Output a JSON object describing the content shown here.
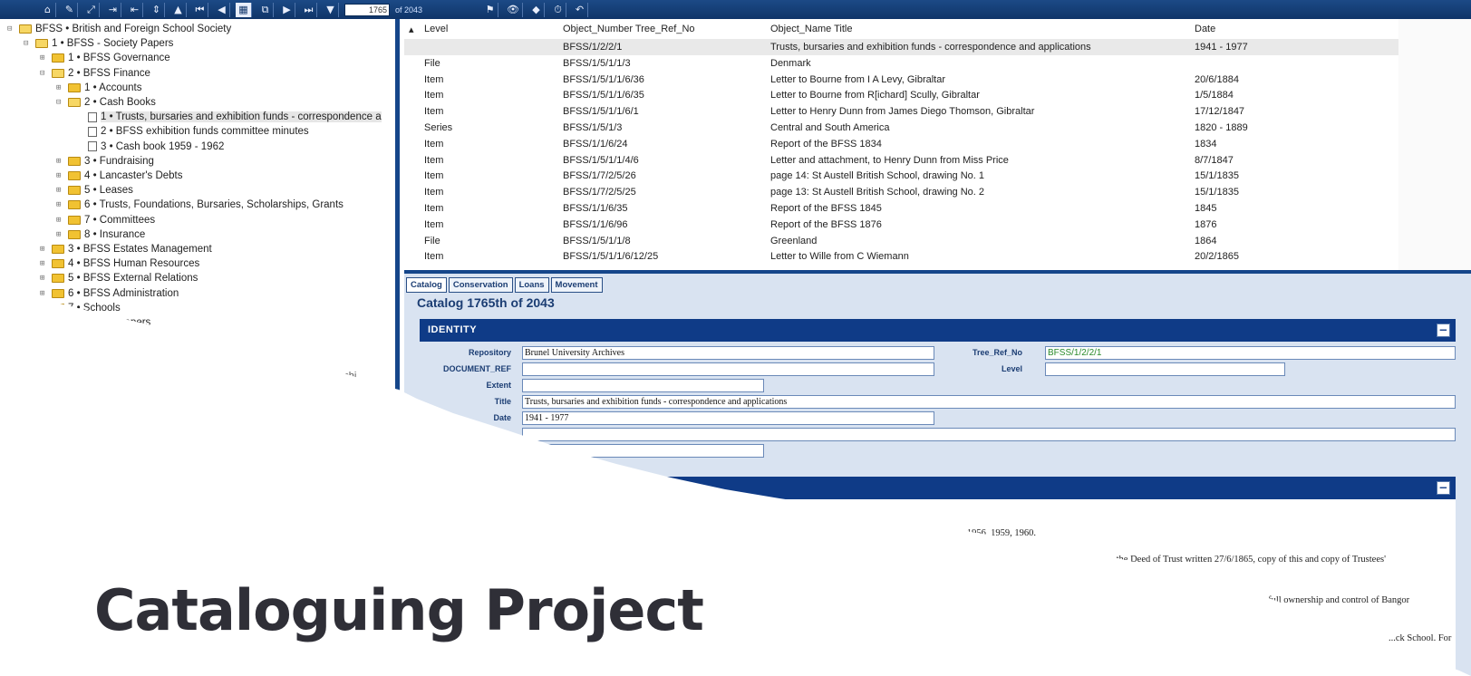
{
  "toolbar": {
    "buttons": [
      "⌂",
      "✎",
      "⤢",
      "⇥",
      "⇤",
      "⇕",
      "▲",
      "⏮",
      "◀",
      "▦",
      "⧉",
      "▶",
      "⏭",
      "▼"
    ],
    "record_value": "1765",
    "record_of": "of 2043",
    "right_buttons": [
      "⚑",
      "👁",
      "◆",
      "⏱",
      "↶"
    ]
  },
  "tree": {
    "items": [
      {
        "exp": "⊟",
        "icon": "folder open",
        "label": "BFSS • British and Foreign School Society"
      },
      {
        "exp": "⊟",
        "icon": "folder open",
        "label": "1 • BFSS - Society Papers"
      },
      {
        "exp": "⊞",
        "icon": "folder",
        "label": "1 • BFSS Governance"
      },
      {
        "exp": "⊟",
        "icon": "folder open",
        "label": "2 • BFSS Finance"
      },
      {
        "exp": "⊞",
        "icon": "folder",
        "label": "1 • Accounts"
      },
      {
        "exp": "⊟",
        "icon": "folder open",
        "label": "2 • Cash Books"
      },
      {
        "exp": "",
        "icon": "doc",
        "label": "1 • Trusts, bursaries and exhibition funds - correspondence a"
      },
      {
        "exp": "",
        "icon": "doc",
        "label": "2 • BFSS exhibition funds committee minutes"
      },
      {
        "exp": "",
        "icon": "doc",
        "label": "3 • Cash book 1959 - 1962"
      },
      {
        "exp": "⊞",
        "icon": "folder",
        "label": "3 • Fundraising"
      },
      {
        "exp": "⊞",
        "icon": "folder",
        "label": "4 • Lancaster's Debts"
      },
      {
        "exp": "⊞",
        "icon": "folder",
        "label": "5 • Leases"
      },
      {
        "exp": "⊞",
        "icon": "folder",
        "label": "6 • Trusts, Foundations, Bursaries, Scholarships, Grants"
      },
      {
        "exp": "⊞",
        "icon": "folder",
        "label": "7 • Committees"
      },
      {
        "exp": "⊞",
        "icon": "folder",
        "label": "8 • Insurance"
      },
      {
        "exp": "⊞",
        "icon": "folder",
        "label": "3 • BFSS Estates Management"
      },
      {
        "exp": "⊞",
        "icon": "folder",
        "label": "4 • BFSS Human Resources"
      },
      {
        "exp": "⊞",
        "icon": "folder",
        "label": "5 • BFSS External Relations"
      },
      {
        "exp": "⊞",
        "icon": "folder",
        "label": "6 • BFSS Administration"
      },
      {
        "exp": "⊞",
        "icon": "folder",
        "label": "7 • Schools"
      },
      {
        "exp": "",
        "icon": "",
        "label": "...nal papers"
      }
    ],
    "fragment": "...se Archi"
  },
  "grid": {
    "headers": [
      "Level",
      "Object_Number Tree_Ref_No",
      "Object_Name Title",
      "Date"
    ],
    "rows": [
      [
        "",
        "BFSS/1/2/2/1",
        "Trusts, bursaries and exhibition funds - correspondence and applications",
        "1941 - 1977"
      ],
      [
        "File",
        "BFSS/1/5/1/1/3",
        "Denmark",
        ""
      ],
      [
        "Item",
        "BFSS/1/5/1/1/6/36",
        "Letter to Bourne from I A Levy, Gibraltar",
        "20/6/1884"
      ],
      [
        "Item",
        "BFSS/1/5/1/1/6/35",
        "Letter to Bourne from R[ichard] Scully, Gibraltar",
        "1/5/1884"
      ],
      [
        "Item",
        "BFSS/1/5/1/1/6/1",
        "Letter to Henry Dunn from James Diego Thomson, Gibraltar",
        "17/12/1847"
      ],
      [
        "Series",
        "BFSS/1/5/1/3",
        "Central and South America",
        "1820 - 1889"
      ],
      [
        "Item",
        "BFSS/1/1/6/24",
        "Report of the BFSS 1834",
        "1834"
      ],
      [
        "Item",
        "BFSS/1/5/1/1/4/6",
        "Letter and attachment, to Henry Dunn from Miss Price",
        "8/7/1847"
      ],
      [
        "Item",
        "BFSS/1/7/2/5/26",
        "page 14: St Austell British School, drawing No. 1",
        "15/1/1835"
      ],
      [
        "Item",
        "BFSS/1/7/2/5/25",
        "page 13: St Austell British School, drawing No. 2",
        "15/1/1835"
      ],
      [
        "Item",
        "BFSS/1/1/6/35",
        "Report of the BFSS 1845",
        "1845"
      ],
      [
        "Item",
        "BFSS/1/1/6/96",
        "Report of the BFSS 1876",
        "1876"
      ],
      [
        "File",
        "BFSS/1/5/1/1/8",
        "Greenland",
        "1864"
      ],
      [
        "Item",
        "BFSS/1/5/1/1/6/12/25",
        "Letter to Wille from C Wiemann",
        "20/2/1865"
      ]
    ]
  },
  "detail": {
    "tabs": [
      "Catalog",
      "Conservation",
      "Loans",
      "Movement"
    ],
    "counter": "Catalog 1765th of 2043",
    "identity_title": "IDENTITY",
    "collapse_label": "−",
    "fields": {
      "repository_label": "Repository",
      "repository_value": "Brunel University Archives",
      "document_ref_label": "DOCUMENT_REF",
      "document_ref_value": "",
      "extent_label": "Extent",
      "extent_value": "",
      "title_label": "Title",
      "title_value": "Trusts, bursaries and exhibition funds - correspondence and applications",
      "date_label": "Date",
      "date_value": "1941 - 1977",
      "tree_ref_label": "Tree_Ref_No",
      "tree_ref_value": "BFSS/1/2/2/1",
      "level_label": "Level",
      "level_value": ""
    },
    "description_lines": [
      "...1956, 1959, 1960.",
      "...ting to the Deed of Trust written 27/6/1865, copy of this and copy of Trustees'",
      "...handed over full ownership and control of Bangor",
      "...ck School. For"
    ]
  },
  "overlay_title": "Cataloguing Project"
}
